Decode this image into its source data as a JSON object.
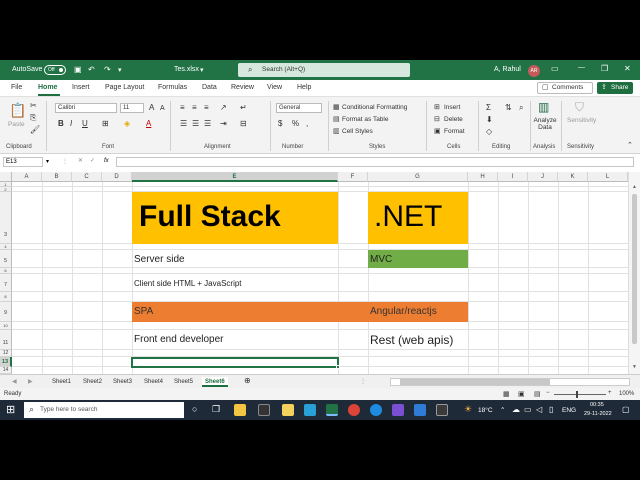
{
  "title_bar": {
    "autosave_label": "AutoSave",
    "autosave_state": "Off",
    "file_name": "Tes.xlsx",
    "search_placeholder": "Search (Alt+Q)",
    "user_name": "A, Rahul",
    "user_initials": "AR"
  },
  "menu": {
    "tabs": [
      "File",
      "Home",
      "Insert",
      "Page Layout",
      "Formulas",
      "Data",
      "Review",
      "View",
      "Help"
    ],
    "active_tab": "Home",
    "comments_label": "Comments",
    "share_label": "Share"
  },
  "ribbon": {
    "clipboard": {
      "paste": "Paste",
      "group": "Clipboard"
    },
    "font": {
      "name": "Calibri",
      "size": "11",
      "group": "Font"
    },
    "alignment": {
      "group": "Alignment"
    },
    "number": {
      "format": "General",
      "group": "Number"
    },
    "styles": {
      "conditional": "Conditional Formatting",
      "format_table": "Format as Table",
      "cell_styles": "Cell Styles",
      "group": "Styles"
    },
    "cells": {
      "insert": "Insert",
      "delete": "Delete",
      "format": "Format",
      "group": "Cells"
    },
    "editing": {
      "group": "Editing"
    },
    "analysis": {
      "analyze": "Analyze Data",
      "group": "Analysis"
    },
    "sensitivity": {
      "label": "Sensitivity",
      "group": "Sensitivity"
    }
  },
  "formula_bar": {
    "name_box": "E13",
    "fx": "fx",
    "value": ""
  },
  "columns": [
    "A",
    "B",
    "C",
    "D",
    "E",
    "F",
    "G",
    "H",
    "I",
    "J",
    "K",
    "L"
  ],
  "rows": [
    "1",
    "2",
    "3",
    "4",
    "5",
    "6",
    "7",
    "8",
    "9",
    "10",
    "11",
    "12",
    "13",
    "14"
  ],
  "cells": {
    "e3": "Full Stack",
    "g3": ".NET",
    "e5": "Server side",
    "g5": "MVC",
    "e7": "Client side HTML + JavaScript",
    "e9": "SPA",
    "g9": "Angular/reactjs",
    "e11": "Front end developer",
    "g11": "Rest (web apis)"
  },
  "colors": {
    "excel_green": "#217346",
    "yellow": "#ffc000",
    "green_fill": "#70ad47",
    "orange_fill": "#ed7d31"
  },
  "sheets": [
    "Sheet1",
    "Sheet2",
    "Sheet3",
    "Sheet4",
    "Sheet5",
    "Sheet6"
  ],
  "active_sheet": "Sheet6",
  "status": {
    "ready": "Ready",
    "zoom": "100%"
  },
  "taskbar": {
    "search_placeholder": "Type here to search",
    "temperature": "18°C",
    "language": "ENG",
    "time": "00:35",
    "date": "29-11-2022"
  }
}
